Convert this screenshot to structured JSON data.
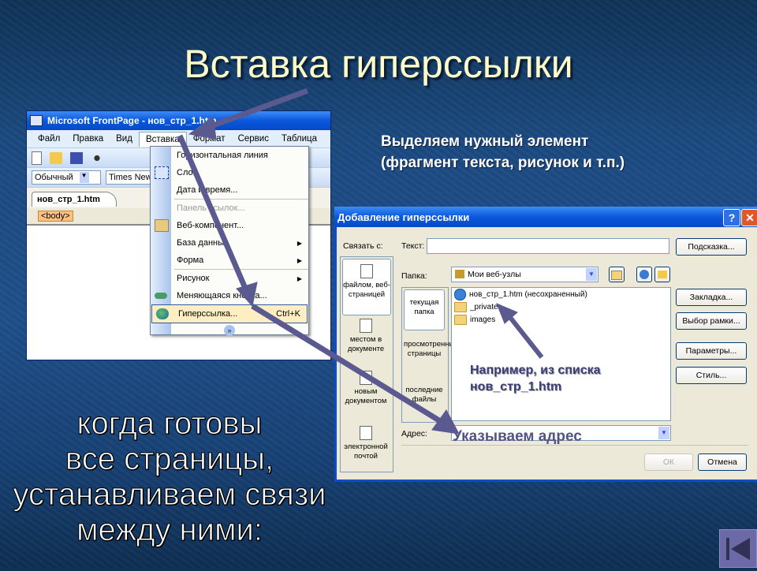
{
  "slide": {
    "title": "Вставка гиперссылки",
    "note_top": [
      "Выделяем нужный элемент",
      "(фрагмент текста, рисунок и т.п.)"
    ],
    "note_bottom": [
      "когда готовы",
      "все страницы,",
      "устанавливаем связи",
      "между ними:"
    ],
    "hint_list": [
      "Например, из списка",
      "нов_стр_1.htm"
    ],
    "hint_address": "Указываем адрес",
    "nav_back_icon": "first-slide-icon"
  },
  "frontpage": {
    "title": "Microsoft FrontPage - нов_стр_1.htm",
    "menubar": [
      "Файл",
      "Правка",
      "Вид",
      "Вставка",
      "Формат",
      "Сервис",
      "Таблица"
    ],
    "active_menu": "Вставка",
    "style_combo": "Обычный",
    "font_combo": "Times New",
    "tab": "нов_стр_1.htm",
    "tag": "<body>"
  },
  "insert_menu": {
    "items": [
      {
        "label": "Горизонтальная линия",
        "icon": "",
        "disabled": false
      },
      {
        "label": "Слой",
        "icon": "layer-icon",
        "disabled": false
      },
      {
        "label": "Дата и время...",
        "icon": "",
        "disabled": false
      },
      {
        "label": "Панель ссылок...",
        "icon": "",
        "disabled": true
      },
      {
        "label": "Веб-компонент...",
        "icon": "web-component-icon",
        "disabled": false
      },
      {
        "label": "База данных",
        "icon": "",
        "submenu": true
      },
      {
        "label": "Форма",
        "icon": "",
        "submenu": true
      },
      {
        "label": "Рисунок",
        "icon": "",
        "submenu": true
      },
      {
        "label": "Меняющаяся кнопка...",
        "icon": "interactive-button-icon"
      },
      {
        "label": "Гиперссылка...",
        "icon": "hyperlink-icon",
        "shortcut": "Ctrl+K",
        "selected": true
      }
    ]
  },
  "dialog": {
    "title": "Добавление гиперссылки",
    "link_to_label": "Связать с:",
    "text_label": "Текст:",
    "text_value": "",
    "folder_label": "Папка:",
    "folder_value": "Мои веб-узлы",
    "address_label": "Адрес:",
    "address_value": "",
    "link_bar": [
      {
        "label": "файлом, веб-страницей",
        "selected": true
      },
      {
        "label": "местом в документе"
      },
      {
        "label": "новым документом"
      },
      {
        "label": "электронной почтой"
      }
    ],
    "look_in": [
      {
        "label": "текущая папка",
        "selected": true
      },
      {
        "label": "просмотренные страницы"
      },
      {
        "label": "последние файлы"
      }
    ],
    "files": [
      {
        "name": "нов_стр_1.htm (несохраненный)",
        "type": "page"
      },
      {
        "name": "_private",
        "type": "folder"
      },
      {
        "name": "images",
        "type": "folder"
      }
    ],
    "buttons": {
      "tooltip": "Подсказка...",
      "bookmark": "Закладка...",
      "frame": "Выбор рамки...",
      "params": "Параметры...",
      "style": "Стиль...",
      "ok": "ОК",
      "cancel": "Отмена"
    }
  }
}
